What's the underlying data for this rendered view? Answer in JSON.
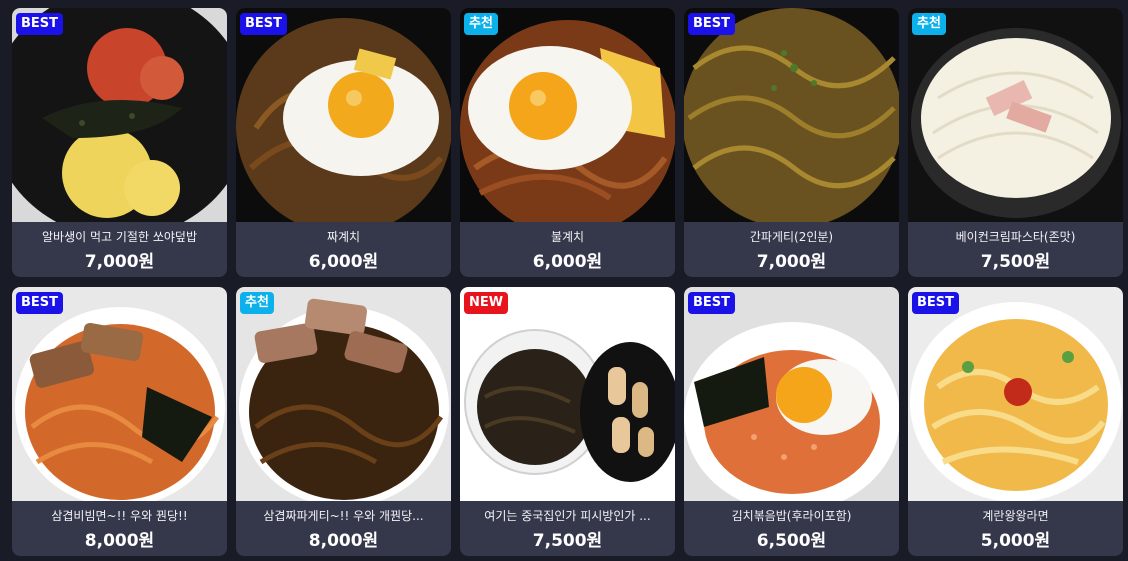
{
  "menu": [
    {
      "badge": "BEST",
      "badge_type": "best",
      "name": "알바생이 먹고 기절한 쏘야덮밥",
      "price": "7,000원",
      "photo": "rice-bowl-photo"
    },
    {
      "badge": "BEST",
      "badge_type": "best",
      "name": "짜계치",
      "price": "6,000원",
      "photo": "noodle-egg-photo"
    },
    {
      "badge": "추천",
      "badge_type": "rec",
      "name": "불계치",
      "price": "6,000원",
      "photo": "spicy-noodle-egg-photo"
    },
    {
      "badge": "BEST",
      "badge_type": "best",
      "name": "간파게티(2인분)",
      "price": "7,000원",
      "photo": "black-noodle-photo"
    },
    {
      "badge": "추천",
      "badge_type": "rec",
      "name": "베이컨크림파스타(존맛)",
      "price": "7,500원",
      "photo": "cream-pasta-photo"
    },
    {
      "badge": "BEST",
      "badge_type": "best",
      "name": "삼겹비빔면~!! 우와 꿘당!!",
      "price": "8,000원",
      "photo": "pork-bibim-noodle-photo"
    },
    {
      "badge": "추천",
      "badge_type": "rec",
      "name": "삼겹짜파게티~!! 우와 개꿘당...",
      "price": "8,000원",
      "photo": "pork-jjapaghetti-photo"
    },
    {
      "badge": "NEW",
      "badge_type": "new",
      "name": "여기는 중국집인가 피시방인가 ...",
      "price": "7,500원",
      "photo": "jjajang-tangsuyuk-photo"
    },
    {
      "badge": "BEST",
      "badge_type": "best",
      "name": "김치볶음밥(후라이포함)",
      "price": "6,500원",
      "photo": "kimchi-fried-rice-photo"
    },
    {
      "badge": "BEST",
      "badge_type": "best",
      "name": "계란왕왕라면",
      "price": "5,000원",
      "photo": "egg-ramen-photo"
    }
  ],
  "colors": {
    "background": "#191b27",
    "card": "#35374b",
    "best": "#1a12e8",
    "recommend": "#0cb0ea",
    "new": "#e8141d"
  }
}
